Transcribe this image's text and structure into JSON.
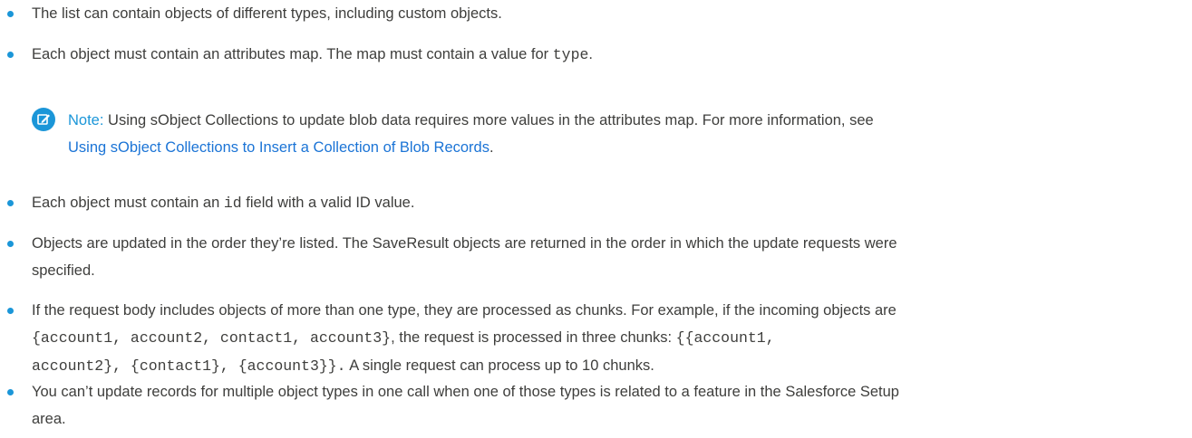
{
  "colors": {
    "bullet": "#1b96d8",
    "note_label": "#1b96d8",
    "link": "#1b74d6",
    "text": "#3e3e3c"
  },
  "items": [
    {
      "t1": "The list can contain objects of different types, including custom objects."
    },
    {
      "t1": "Each object must contain an attributes map. The map must contain a value for ",
      "code1": "type",
      "t2": "."
    },
    {
      "t1": "Each object must contain an ",
      "code1": "id",
      "t2": " field with a valid ID value."
    },
    {
      "line1": "Objects are updated in the order they’re listed. The SaveResult objects are returned in the order in which the update requests were",
      "line2": "specified."
    },
    {
      "line1_a": "If the request body includes objects of more than one type, they are processed as chunks. For example, if the incoming objects are",
      "line2_code1": "{account1, account2, contact1, account3}",
      "line2_text": ", the request is processed in three chunks: ",
      "line2_code2": "{{account1,",
      "line3_code": "account2}, {contact1}, {account3}}.",
      "line3_text": " A single request can process up to 10 chunks."
    },
    {
      "line1": "You can’t update records for multiple object types in one call when one of those types is related to a feature in the Salesforce Setup",
      "line2": "area."
    }
  ],
  "note": {
    "icon": "edit-note-icon",
    "label": "Note:",
    "text_line1": " Using sObject Collections to update blob data requires more values in the attributes map. For more information, see",
    "link": "Using sObject Collections to Insert a Collection of Blob Records",
    "period": "."
  }
}
